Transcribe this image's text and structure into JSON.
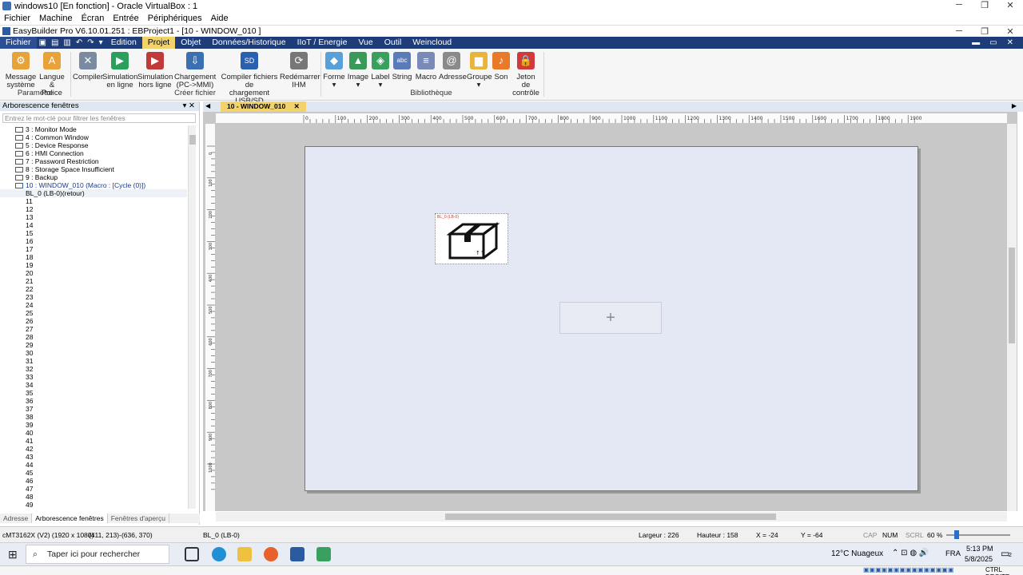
{
  "vbox": {
    "title": "windows10 [En fonction] - Oracle VirtualBox : 1",
    "menu": [
      "Fichier",
      "Machine",
      "Écran",
      "Entrée",
      "Périphériques",
      "Aide"
    ],
    "host_key": "CTRL DROITE"
  },
  "app": {
    "title": "EasyBuilder Pro V6.10.01.251 : EBProject1 - [10 - WINDOW_010 ]"
  },
  "ribbon_tabs": {
    "fichier": "Fichier",
    "edition": "Edition",
    "projet": "Projet",
    "objet": "Objet",
    "donnees": "Données/Historique",
    "iiot": "IIoT / Energie",
    "vue": "Vue",
    "outil": "Outil",
    "weincloud": "Weincloud"
  },
  "ribbon": {
    "message_systeme": [
      "Message",
      "système"
    ],
    "langue_police": [
      "Langue &",
      "Police"
    ],
    "compiler": "Compiler",
    "simulation_en_ligne": [
      "Simulation",
      "en ligne"
    ],
    "simulation_hors_ligne": [
      "Simulation",
      "hors ligne"
    ],
    "chargement": [
      "Chargement",
      "(PC->MMI)"
    ],
    "compiler_fichiers": [
      "Compiler fichiers de",
      "chargement USB/SD"
    ],
    "redemarrer": [
      "Redémarrer",
      "IHM"
    ],
    "forme": "Forme",
    "image": "Image",
    "label": "Label",
    "string": "String",
    "macro": "Macro",
    "adresse": "Adresse",
    "groupe": "Groupe",
    "son": "Son",
    "jeton": [
      "Jeton de",
      "contrôle"
    ],
    "groups": {
      "parametre": "Paramètre",
      "creer_fichier": "Créer fichier",
      "bibliotheque": "Bibliothèque"
    }
  },
  "left_panel": {
    "header": "Arborescence fenêtres",
    "filter_placeholder": "Entrez le mot-clé pour filtrer les fenêtres",
    "tree": [
      "3 : Monitor Mode",
      "4 : Common Window",
      "5 : Device Response",
      "6 : HMI Connection",
      "7 : Password Restriction",
      "8 : Storage Space Insufficient",
      "9 : Backup",
      "10 : WINDOW_010 (Macro : [Cycle (0)])",
      "BL_0 (LB-0)(retour)",
      "11",
      "12",
      "13",
      "14",
      "15",
      "16",
      "17",
      "18",
      "19",
      "20",
      "21",
      "22",
      "23",
      "24",
      "25",
      "26",
      "27",
      "28",
      "29",
      "30",
      "31",
      "32",
      "33",
      "34",
      "35",
      "36",
      "37",
      "38",
      "39",
      "40",
      "41",
      "42",
      "43",
      "44",
      "45",
      "46",
      "47",
      "48",
      "49"
    ],
    "tabs": [
      "Adresse",
      "Arborescence fenêtres",
      "Fenêtres d'aperçu"
    ]
  },
  "editor": {
    "tab_label": "10 - WINDOW_010",
    "object_label": "BL_0 (LB-0)",
    "ruler_h": [
      "0",
      "100",
      "200",
      "300",
      "400",
      "500",
      "600",
      "700",
      "800",
      "900",
      "1000",
      "1100",
      "1200",
      "1300",
      "1400",
      "1500",
      "1600",
      "1700",
      "1800",
      "1900"
    ],
    "ruler_v": [
      "0",
      "100",
      "200",
      "300",
      "400",
      "500",
      "600",
      "700",
      "800",
      "900",
      "1000"
    ]
  },
  "status": {
    "model": "cMT3162X (V2) (1920 x 1080)",
    "coords": "(411, 213)-(636, 370)",
    "object": "BL_0 (LB-0)",
    "largeur": "Largeur : 226",
    "hauteur": "Hauteur : 158",
    "x": "X = -24",
    "y": "Y = -64",
    "cap": "CAP",
    "num": "NUM",
    "scrl": "SCRL",
    "zoom": "60 %"
  },
  "taskbar": {
    "search_placeholder": "Taper ici pour rechercher",
    "weather": "12°C  Nuageux",
    "lang": "FRA",
    "time": "5:13 PM",
    "date": "5/8/2025",
    "notif_count": "2"
  }
}
